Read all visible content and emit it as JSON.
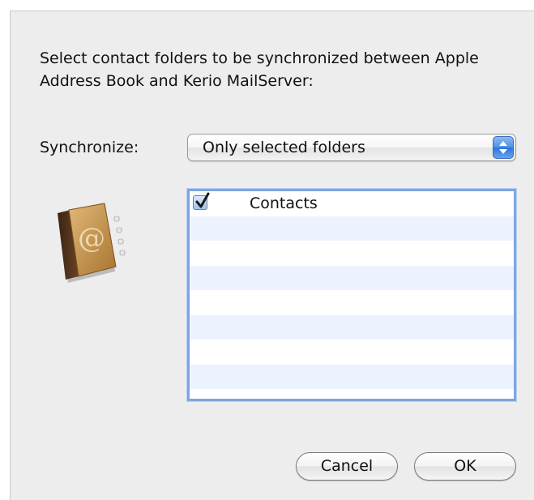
{
  "dialog": {
    "prompt": "Select contact folders to be synchronized between Apple Address Book and Kerio MailServer:",
    "synchronize_label": "Synchronize:",
    "synchronize_value": "Only selected folders",
    "folders": [
      {
        "label": "Contacts",
        "checked": true
      }
    ],
    "cancel_label": "Cancel",
    "ok_label": "OK"
  },
  "icons": {
    "app_icon": "address-book-icon",
    "popup_arrows": "up-down-arrows-icon",
    "checkmark": "checkmark-icon"
  },
  "colors": {
    "dialog_bg": "#ededed",
    "list_focus_ring": "#7ea5e0",
    "list_alt_row": "#edf3fe",
    "popup_arrow_blue": "#4f8fe6"
  }
}
